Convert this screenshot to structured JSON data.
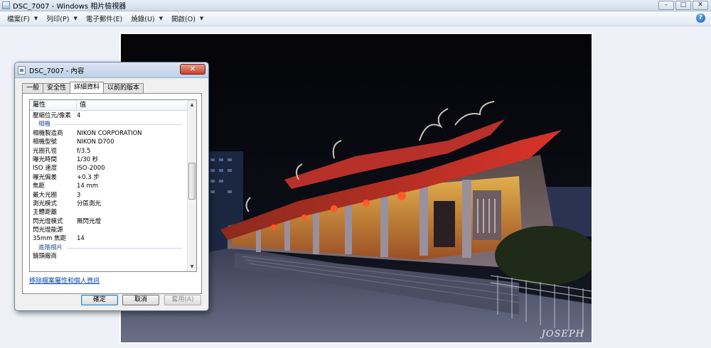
{
  "window": {
    "title": "DSC_7007 - Windows 相片檢視器",
    "controls": {
      "minimize": "–",
      "maximize": "□",
      "close": "✕"
    }
  },
  "menubar": {
    "items": [
      {
        "label": "檔案(F)",
        "icon": "chevron-down-icon"
      },
      {
        "label": "列印(P)",
        "icon": "chevron-down-icon"
      },
      {
        "label": "電子郵件(E)"
      },
      {
        "label": "燒錄(U)",
        "icon": "chevron-down-icon"
      },
      {
        "label": "開啟(O)",
        "icon": "chevron-down-icon"
      }
    ],
    "help": "?"
  },
  "photo": {
    "watermark": "JOSEPH"
  },
  "dialog": {
    "title": "DSC_7007 - 內容",
    "close": "✕",
    "tabs": [
      {
        "label": "一般",
        "active": false
      },
      {
        "label": "安全性",
        "active": false
      },
      {
        "label": "詳細資料",
        "active": true
      },
      {
        "label": "以前的版本",
        "active": false
      }
    ],
    "columns": {
      "property": "屬性",
      "value": "值"
    },
    "rows": [
      {
        "type": "row",
        "k": "壓縮位元/像素",
        "v": "4"
      },
      {
        "type": "group",
        "k": "相機"
      },
      {
        "type": "row",
        "k": "相機製造商",
        "v": "NIKON CORPORATION"
      },
      {
        "type": "row",
        "k": "相機型號",
        "v": "NIKON D700"
      },
      {
        "type": "row",
        "k": "光圈孔徑",
        "v": "f/3.5"
      },
      {
        "type": "row",
        "k": "曝光時間",
        "v": "1/30 秒"
      },
      {
        "type": "row",
        "k": "ISO 速度",
        "v": "ISO-2000"
      },
      {
        "type": "row",
        "k": "曝光偏差",
        "v": "+0.3 步"
      },
      {
        "type": "row",
        "k": "焦距",
        "v": "14 mm"
      },
      {
        "type": "row",
        "k": "最大光圈",
        "v": "3"
      },
      {
        "type": "row",
        "k": "測光模式",
        "v": "分區測光"
      },
      {
        "type": "row",
        "k": "主體距離",
        "v": ""
      },
      {
        "type": "row",
        "k": "閃光燈模式",
        "v": "無閃光燈"
      },
      {
        "type": "row",
        "k": "閃光燈能源",
        "v": ""
      },
      {
        "type": "row",
        "k": "35mm 焦距",
        "v": "14"
      },
      {
        "type": "group",
        "k": "進階相片"
      },
      {
        "type": "row",
        "k": "鏡頭廠商",
        "v": ""
      }
    ],
    "remove_link": "移除檔案屬性和個人資訊",
    "buttons": {
      "ok": "確定",
      "cancel": "取消",
      "apply": "套用(A)"
    }
  }
}
